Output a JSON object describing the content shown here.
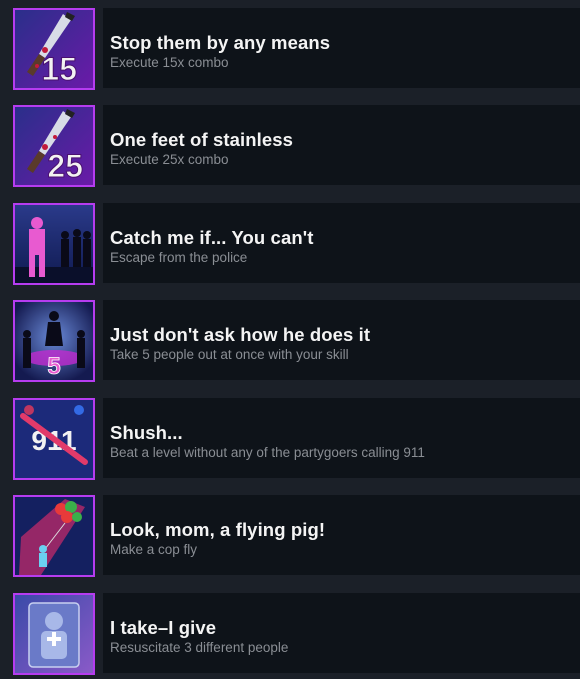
{
  "achievements": [
    {
      "title": "Stop them by any means",
      "desc": "Execute 15x combo",
      "icon": "knife-15-icon",
      "badge": "15"
    },
    {
      "title": "One feet of stainless",
      "desc": "Execute 25x combo",
      "icon": "knife-25-icon",
      "badge": "25"
    },
    {
      "title": "Catch me if... You can't",
      "desc": "Escape from the police",
      "icon": "escape-police-icon"
    },
    {
      "title": "Just don't ask how he does it",
      "desc": "Take 5 people out at once with your skill",
      "icon": "dancers-5-icon",
      "badge": "5"
    },
    {
      "title": "Shush...",
      "desc": "Beat a level without any of the partygoers calling 911",
      "icon": "no-911-icon",
      "badge": "911"
    },
    {
      "title": "Look, mom, a flying pig!",
      "desc": "Make a cop fly",
      "icon": "flying-cop-balloons-icon"
    },
    {
      "title": "I take–I give",
      "desc": "Resuscitate 3 different people",
      "icon": "resuscitate-icon"
    }
  ],
  "colors": {
    "background": "#1b2028",
    "panel": "#0e1319",
    "icon_border": "#b63cf0",
    "title": "#f4f4f4",
    "desc": "#8a8e94"
  }
}
